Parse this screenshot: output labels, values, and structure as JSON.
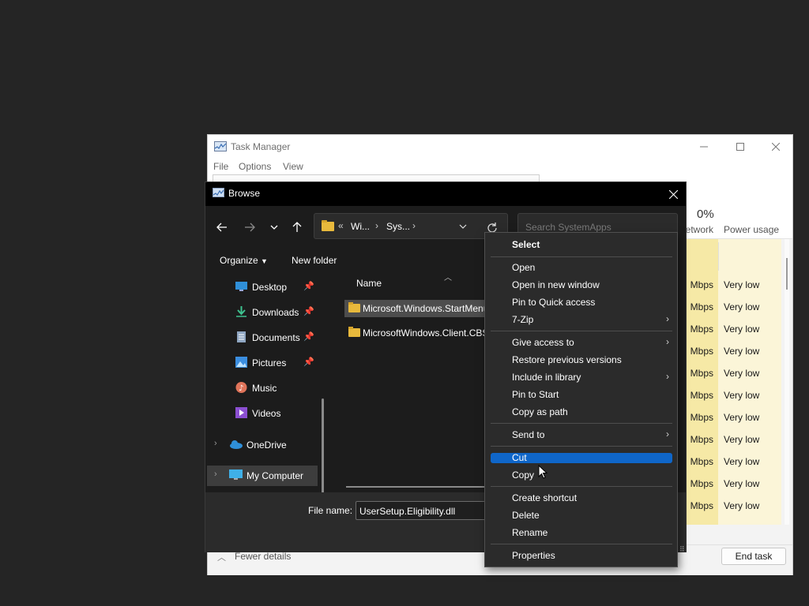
{
  "task_manager": {
    "title": "Task Manager",
    "menus": [
      "File",
      "Options",
      "View"
    ],
    "network_percent": "0%",
    "col_network": "Network",
    "col_power": "Power usage",
    "rows": [
      {
        "net": "Mbps",
        "power": "Very low"
      },
      {
        "net": "Mbps",
        "power": "Very low"
      },
      {
        "net": "Mbps",
        "power": "Very low"
      },
      {
        "net": "Mbps",
        "power": "Very low"
      },
      {
        "net": "Mbps",
        "power": "Very low"
      },
      {
        "net": "Mbps",
        "power": "Very low"
      },
      {
        "net": "Mbps",
        "power": "Very low"
      },
      {
        "net": "Mbps",
        "power": "Very low"
      },
      {
        "net": "Mbps",
        "power": "Very low"
      },
      {
        "net": "Mbps",
        "power": "Very low"
      },
      {
        "net": "Mbps",
        "power": "Very low"
      }
    ],
    "fewer_details": "Fewer details",
    "end_task": "End task"
  },
  "browse": {
    "title": "Browse",
    "address": {
      "overflow": "«",
      "segments": [
        "Wi...",
        "Sys..."
      ]
    },
    "search_placeholder": "Search SystemApps",
    "organize": "Organize",
    "new_folder": "New folder",
    "nav": [
      {
        "label": "Desktop",
        "icon": "desktop-icon",
        "pinned": true
      },
      {
        "label": "Downloads",
        "icon": "downloads-icon",
        "pinned": true
      },
      {
        "label": "Documents",
        "icon": "documents-icon",
        "pinned": true
      },
      {
        "label": "Pictures",
        "icon": "pictures-icon",
        "pinned": true
      },
      {
        "label": "Music",
        "icon": "music-icon",
        "pinned": false
      },
      {
        "label": "Videos",
        "icon": "videos-icon",
        "pinned": false
      },
      {
        "label": "OneDrive",
        "icon": "onedrive-icon",
        "pinned": false
      },
      {
        "label": "My Computer",
        "icon": "computer-icon",
        "pinned": false
      }
    ],
    "column_name": "Name",
    "files": [
      {
        "name": "Microsoft.Windows.StartMenuExperienceHost",
        "selected": true
      },
      {
        "name": "MicrosoftWindows.Client.CBS",
        "selected": false
      }
    ],
    "file_name_label": "File name:",
    "file_name_value": "UserSetup.Eligibility.dll"
  },
  "context_menu": {
    "items": [
      {
        "label": "Select",
        "bold": true,
        "submenu": false
      },
      {
        "label": "Open",
        "submenu": false
      },
      {
        "label": "Open in new window",
        "submenu": false
      },
      {
        "label": "Pin to Quick access",
        "submenu": false
      },
      {
        "label": "7-Zip",
        "submenu": true
      },
      {
        "label": "Give access to",
        "submenu": true
      },
      {
        "label": "Restore previous versions",
        "submenu": false
      },
      {
        "label": "Include in library",
        "submenu": true
      },
      {
        "label": "Pin to Start",
        "submenu": false
      },
      {
        "label": "Copy as path",
        "submenu": false
      },
      {
        "label": "Send to",
        "submenu": true
      },
      {
        "label": "Cut",
        "submenu": false,
        "highlighted": true
      },
      {
        "label": "Copy",
        "submenu": false
      },
      {
        "label": "Create shortcut",
        "submenu": false
      },
      {
        "label": "Delete",
        "submenu": false
      },
      {
        "label": "Rename",
        "submenu": false
      },
      {
        "label": "Properties",
        "submenu": false
      }
    ]
  }
}
